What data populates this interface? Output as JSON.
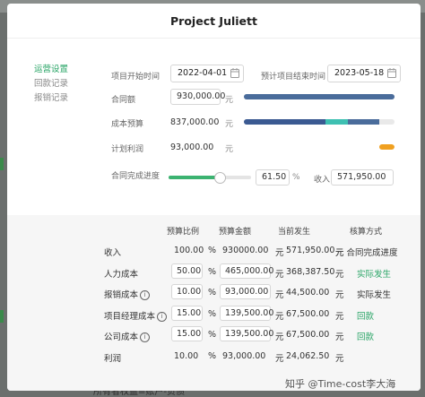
{
  "modal": {
    "title": "Project Juliett"
  },
  "sidebar": {
    "items": [
      {
        "label": "运营设置",
        "active": true
      },
      {
        "label": "回款记录",
        "active": false
      },
      {
        "label": "报销记录",
        "active": false
      }
    ]
  },
  "form": {
    "start_date_label": "项目开始时间",
    "start_date": "2022-04-01",
    "end_date_label": "预计项目结束时间",
    "end_date": "2023-05-18",
    "contract_label": "合同额",
    "contract_value": "930,000.00",
    "cost_budget_label": "成本预算",
    "cost_budget_value": "837,000.00",
    "planned_profit_label": "计划利润",
    "planned_profit_value": "93,000.00",
    "unit_yuan": "元",
    "progress_label": "合同完成进度",
    "progress_value": "61.50",
    "progress_unit": "%",
    "income_label": "收入",
    "income_value": "571,950.00",
    "progress_fraction": 0.615
  },
  "bars": {
    "contract": {
      "fill": 1.0,
      "color": "#4a6c9b"
    },
    "cost": {
      "segments": [
        {
          "fraction": 0.54,
          "color": "#3b5a92"
        },
        {
          "fraction": 0.15,
          "color": "#3ec0b2"
        },
        {
          "fraction": 0.21,
          "color": "#4a6c9b"
        }
      ]
    },
    "profit": {
      "color": "#f0a020",
      "fraction": 0.1
    }
  },
  "table": {
    "headers": [
      "预算比例",
      "预算金额",
      "当前发生",
      "核算方式"
    ],
    "rows": [
      {
        "name": "收入",
        "info": false,
        "ratio": "100.00",
        "ratio_editable": false,
        "budget": "930000.00",
        "budget_editable": false,
        "current": "571,950.00",
        "method": "元 合同完成进度",
        "method_link": false
      },
      {
        "name": "人力成本",
        "info": false,
        "ratio": "50.00",
        "ratio_editable": true,
        "budget": "465,000.00",
        "budget_editable": true,
        "current": "368,387.50",
        "method": "实际发生",
        "method_link": true
      },
      {
        "name": "报销成本",
        "info": true,
        "ratio": "10.00",
        "ratio_editable": true,
        "budget": "93,000.00",
        "budget_editable": true,
        "current": "44,500.00",
        "method": "实际发生",
        "method_link": false
      },
      {
        "name": "项目经理成本",
        "info": true,
        "ratio": "15.00",
        "ratio_editable": true,
        "budget": "139,500.00",
        "budget_editable": true,
        "current": "67,500.00",
        "method": "回款",
        "method_link": true
      },
      {
        "name": "公司成本",
        "info": true,
        "ratio": "15.00",
        "ratio_editable": true,
        "budget": "139,500.00",
        "budget_editable": true,
        "current": "67,500.00",
        "method": "回款",
        "method_link": true
      },
      {
        "name": "利润",
        "info": false,
        "ratio": "10.00",
        "ratio_editable": false,
        "budget": "93,000.00",
        "budget_editable": false,
        "current": "24,062.50",
        "method": "",
        "method_link": false
      }
    ],
    "unit_percent": "%",
    "unit_yuan": "元"
  },
  "watermark": "知乎 @Time-cost李大海",
  "background_text": "所有者权益=账户-负债"
}
